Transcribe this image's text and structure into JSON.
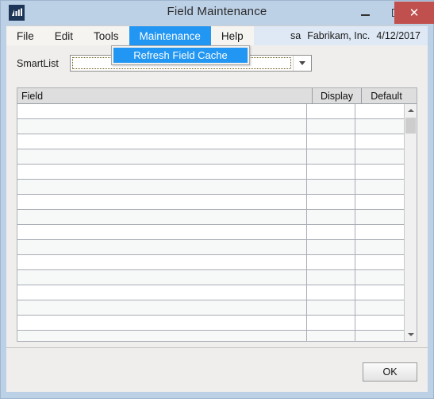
{
  "window": {
    "title": "Field Maintenance",
    "icon": "chart-app-icon",
    "controls": {
      "minimize": "–",
      "maximize": "□",
      "close": "✕",
      "close_color": "#c0504d"
    },
    "titlebar_color": "#bcd0e6"
  },
  "menubar": {
    "items": [
      {
        "label": "File",
        "active": false
      },
      {
        "label": "Edit",
        "active": false
      },
      {
        "label": "Tools",
        "active": false
      },
      {
        "label": "Maintenance",
        "active": true
      },
      {
        "label": "Help",
        "active": false
      }
    ],
    "active_color": "#2196f3",
    "status": {
      "user": "sa",
      "company": "Fabrikam, Inc.",
      "date": "4/12/2017"
    }
  },
  "dropdown": {
    "open_for": "Maintenance",
    "items": [
      {
        "label": "Refresh Field Cache",
        "highlighted": true
      }
    ],
    "highlight_color": "#2196f3"
  },
  "form": {
    "smartlist": {
      "label": "SmartList",
      "value": "",
      "placeholder": "",
      "dropdown_icon": "chevron-down-icon"
    }
  },
  "grid": {
    "columns": [
      {
        "key": "field",
        "label": "Field"
      },
      {
        "key": "display",
        "label": "Display"
      },
      {
        "key": "default",
        "label": "Default"
      }
    ],
    "rows": [
      {
        "field": "",
        "display": "",
        "default": ""
      },
      {
        "field": "",
        "display": "",
        "default": ""
      },
      {
        "field": "",
        "display": "",
        "default": ""
      },
      {
        "field": "",
        "display": "",
        "default": ""
      },
      {
        "field": "",
        "display": "",
        "default": ""
      },
      {
        "field": "",
        "display": "",
        "default": ""
      },
      {
        "field": "",
        "display": "",
        "default": ""
      },
      {
        "field": "",
        "display": "",
        "default": ""
      },
      {
        "field": "",
        "display": "",
        "default": ""
      },
      {
        "field": "",
        "display": "",
        "default": ""
      },
      {
        "field": "",
        "display": "",
        "default": ""
      },
      {
        "field": "",
        "display": "",
        "default": ""
      },
      {
        "field": "",
        "display": "",
        "default": ""
      },
      {
        "field": "",
        "display": "",
        "default": ""
      },
      {
        "field": "",
        "display": "",
        "default": ""
      },
      {
        "field": "",
        "display": "",
        "default": ""
      }
    ],
    "scrollbar": {
      "up_icon": "scroll-up-arrow-icon",
      "down_icon": "scroll-down-arrow-icon",
      "thumb_position_percent": 0
    }
  },
  "footer": {
    "ok_label": "OK"
  }
}
